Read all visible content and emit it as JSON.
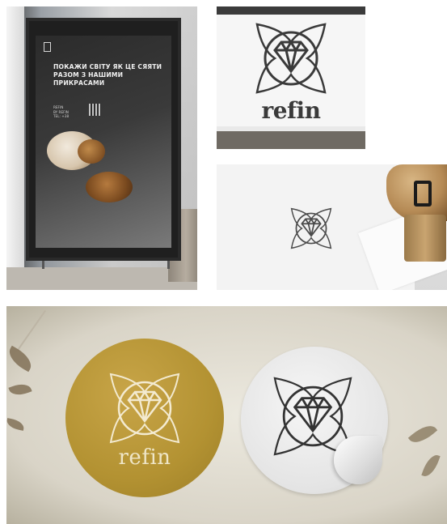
{
  "poster": {
    "headline": "ПОКАЖИ СВІТУ ЯК ЦЕ СЯЯТИ РАЗОМ З НАШИМИ ПРИКРАСАМИ",
    "small_text": "REFIN\nBY REFIN\nTEL: +38"
  },
  "brand": {
    "wordmark_sign": "refin",
    "wordmark_sticker": "refin"
  },
  "icons": {
    "logo": "diamond-emblem-icon"
  },
  "colors": {
    "gold_sticker": "#b39232",
    "sign_band": "#6f6a63",
    "poster_background": "#2b2b2b"
  }
}
